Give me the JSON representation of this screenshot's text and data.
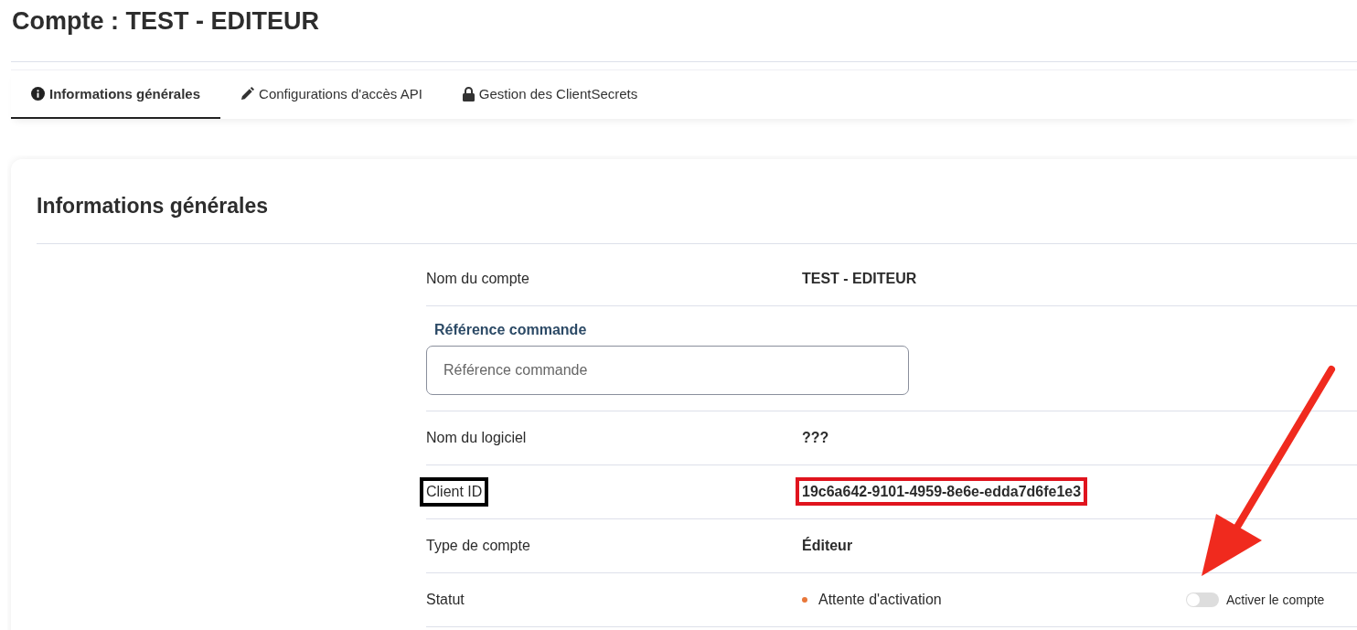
{
  "page_title": "Compte : TEST - EDITEUR",
  "tabs": [
    {
      "label": "Informations générales",
      "selected": true
    },
    {
      "label": "Configurations d'accès API",
      "selected": false
    },
    {
      "label": "Gestion des ClientSecrets",
      "selected": false
    }
  ],
  "card": {
    "title": "Informations générales",
    "rows": [
      {
        "kind": "text",
        "label": "Nom du compte",
        "value": "TEST - EDITEUR"
      },
      {
        "kind": "field",
        "label": "Référence commande",
        "placeholder": "Référence commande"
      },
      {
        "kind": "text",
        "label": "Nom du logiciel",
        "value": "???"
      },
      {
        "kind": "text",
        "label": "Client ID",
        "value": "19c6a642-9101-4959-8e6e-edda7d6fe1e3",
        "label_boxed": true,
        "value_boxed": true
      },
      {
        "kind": "text",
        "label": "Type de compte",
        "value": "Éditeur"
      },
      {
        "kind": "status",
        "label": "Statut",
        "value": "Attente d'activation",
        "color": "#e8773a",
        "toggle": {
          "label": "Activer le compte",
          "on": false
        }
      }
    ]
  }
}
